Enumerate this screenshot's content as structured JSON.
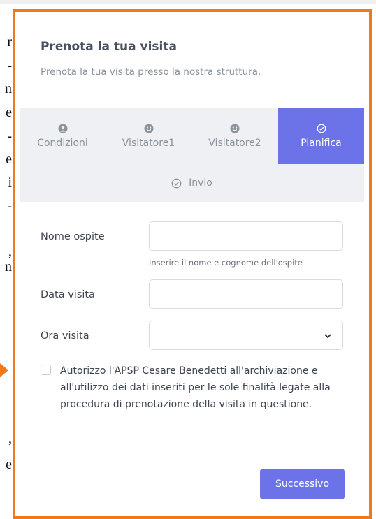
{
  "page": {
    "background_letters": [
      "r",
      "-",
      "n",
      "e",
      "-",
      "e",
      "i",
      "-",
      ",",
      "n",
      ",",
      "e"
    ],
    "accent_color": "#f07a1b"
  },
  "modal": {
    "title": "Prenota la tua visita",
    "subtitle": "Prenota la tua visita presso la nostra struttura."
  },
  "steps": [
    {
      "label": "Condizioni",
      "icon": "user-circle-icon",
      "active": false
    },
    {
      "label": "Visitatore1",
      "icon": "smile-icon",
      "active": false
    },
    {
      "label": "Visitatore2",
      "icon": "smile-icon",
      "active": false
    },
    {
      "label": "Pianifica",
      "icon": "check-circle-icon",
      "active": true
    },
    {
      "label": "Invio",
      "icon": "check-circle-icon",
      "active": false
    }
  ],
  "form": {
    "guest_name_label": "Nome ospite",
    "guest_name_value": "",
    "guest_name_hint": "Inserire il nome e cognome dell'ospite",
    "visit_date_label": "Data visita",
    "visit_date_value": "",
    "visit_time_label": "Ora visita",
    "visit_time_value": "",
    "consent_checked": false,
    "consent_text": "Autorizzo l'APSP Cesare Benedetti all'archiviazione e all'utilizzo dei dati inseriti per le sole finalità legate alla procedura di prenotazione della visita in questione."
  },
  "buttons": {
    "next_label": "Successivo"
  },
  "colors": {
    "primary": "#6c73e8",
    "step_bar_bg": "#eef0f4",
    "frame_border": "#f07a1b"
  }
}
